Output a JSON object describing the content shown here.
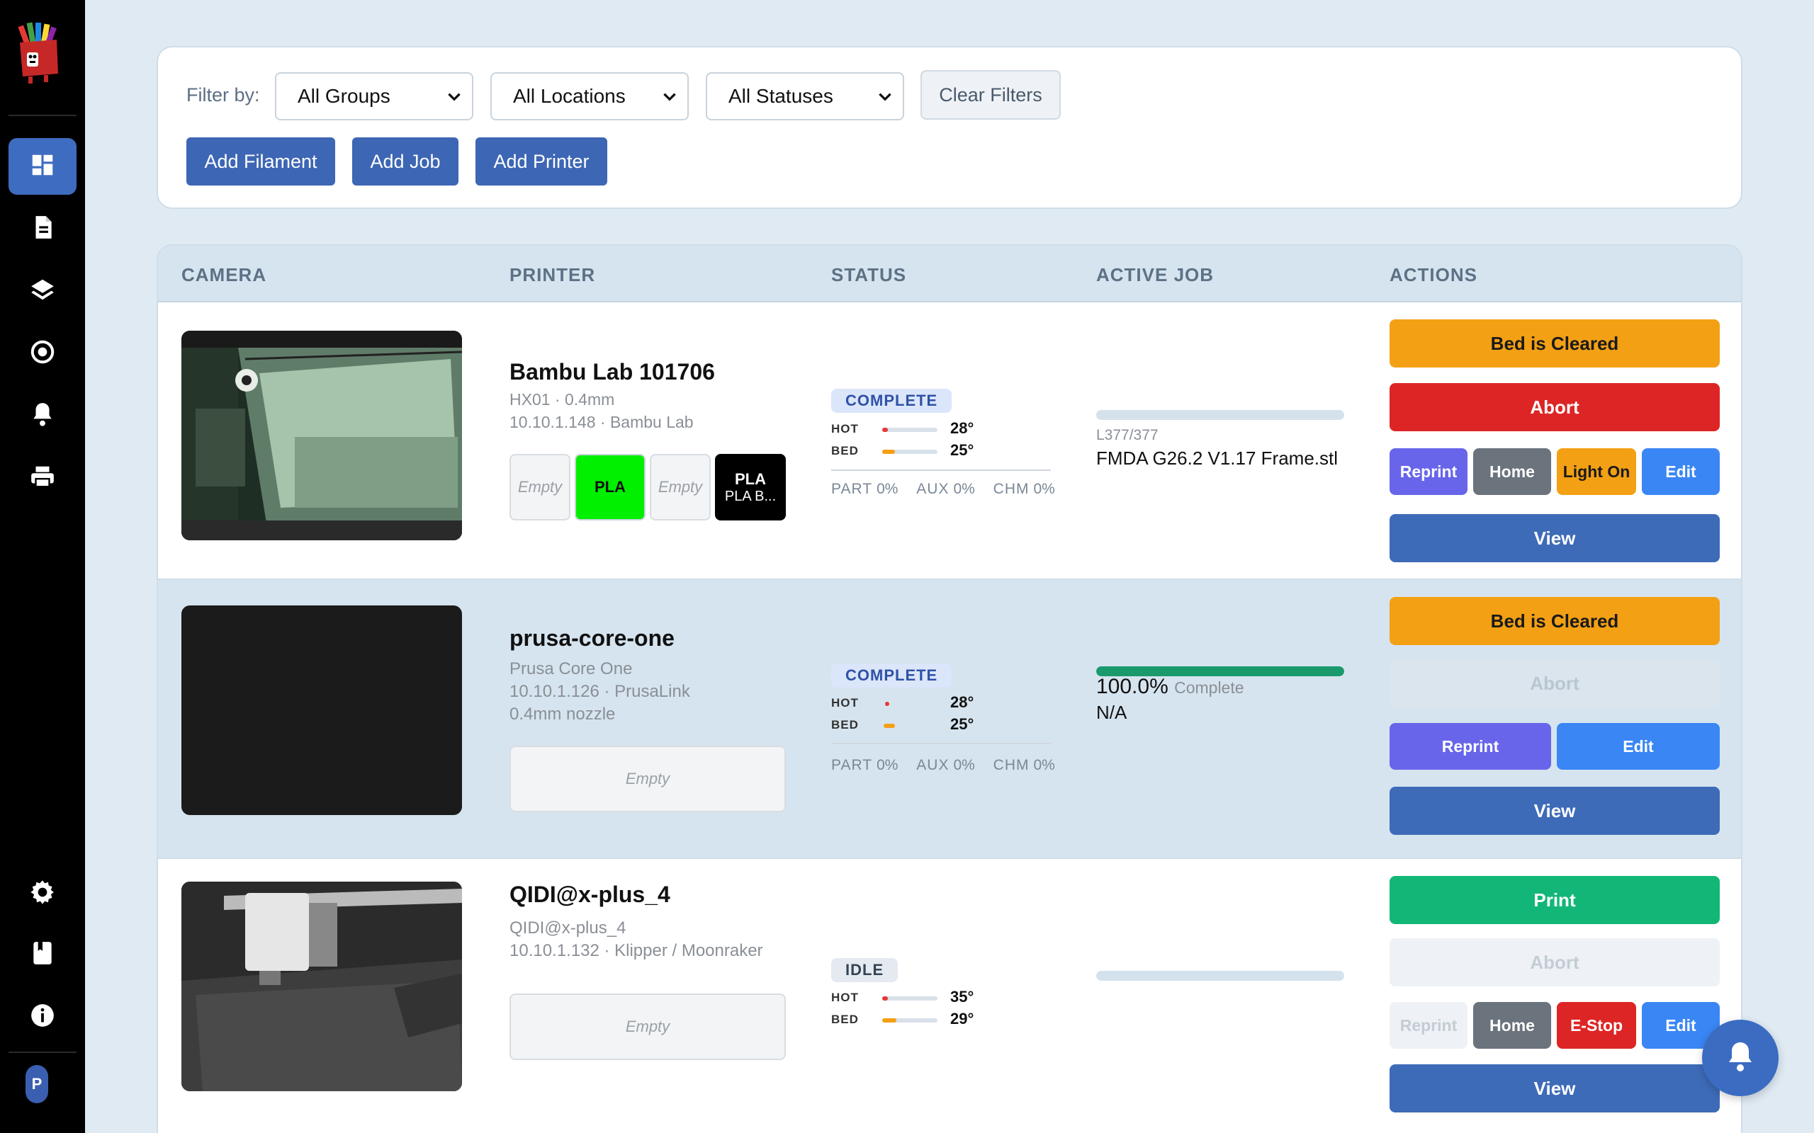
{
  "app": {
    "avatar_letter": "P"
  },
  "sidebar": {
    "items": [
      {
        "icon": "dashboard-icon"
      },
      {
        "icon": "document-icon"
      },
      {
        "icon": "layers-icon"
      },
      {
        "icon": "target-icon"
      },
      {
        "icon": "bell-icon"
      },
      {
        "icon": "printer-icon"
      },
      {
        "icon": "gear-icon"
      },
      {
        "icon": "book-icon"
      },
      {
        "icon": "info-icon"
      }
    ]
  },
  "filters": {
    "label": "Filter by:",
    "groups": "All Groups",
    "locations": "All Locations",
    "statuses": "All Statuses",
    "clear": "Clear Filters",
    "add_filament": "Add Filament",
    "add_job": "Add Job",
    "add_printer": "Add Printer"
  },
  "table": {
    "headers": {
      "camera": "CAMERA",
      "printer": "PRINTER",
      "status": "STATUS",
      "active_job": "ACTIVE JOB",
      "actions": "ACTIONS"
    },
    "rows": [
      {
        "name": "Bambu Lab 101706",
        "model": "HX01 · 0.4mm",
        "address": "10.10.1.148 · Bambu Lab",
        "slots": [
          {
            "label": "Empty"
          },
          {
            "label": "PLA"
          },
          {
            "label": "Empty"
          },
          {
            "label": "PLA",
            "sub": "PLA B..."
          }
        ],
        "status": "COMPLETE",
        "hot_label": "HOT",
        "hot": "28°",
        "bed_label": "BED",
        "bed": "25°",
        "fans": {
          "part_label": "PART",
          "part": "0%",
          "aux_label": "AUX",
          "aux": "0%",
          "chm_label": "CHM",
          "chm": "0%"
        },
        "job_layer": "L377/377",
        "job_file": "FMDA G26.2 V1.17 Frame.stl",
        "actions": {
          "bed_cleared": "Bed is Cleared",
          "abort": "Abort",
          "reprint": "Reprint",
          "home": "Home",
          "light": "Light On",
          "edit": "Edit",
          "view": "View"
        }
      },
      {
        "name": "prusa-core-one",
        "model": "Prusa Core One",
        "address": "10.10.1.126 · PrusaLink",
        "nozzle": "0.4mm nozzle",
        "slots": [
          {
            "label": "Empty"
          }
        ],
        "status": "COMPLETE",
        "hot_label": "HOT",
        "hot": "28°",
        "bed_label": "BED",
        "bed": "25°",
        "fans": {
          "part_label": "PART",
          "part": "0%",
          "aux_label": "AUX",
          "aux": "0%",
          "chm_label": "CHM",
          "chm": "0%"
        },
        "progress": 1.0,
        "job_pct": "100.0%",
        "job_pct_label": "Complete",
        "job_file": "N/A",
        "actions": {
          "bed_cleared": "Bed is Cleared",
          "abort": "Abort",
          "reprint": "Reprint",
          "edit": "Edit",
          "view": "View"
        }
      },
      {
        "name": "QIDI@x-plus_4",
        "model": "QIDI@x-plus_4",
        "address": "10.10.1.132 · Klipper / Moonraker",
        "slots": [
          {
            "label": "Empty"
          }
        ],
        "status": "IDLE",
        "hot_label": "HOT",
        "hot": "35°",
        "bed_label": "BED",
        "bed": "29°",
        "progress": 0,
        "actions": {
          "print": "Print",
          "abort": "Abort",
          "reprint": "Reprint",
          "home": "Home",
          "estop": "E-Stop",
          "edit": "Edit",
          "view": "View"
        }
      }
    ]
  },
  "colors": {
    "sidebar_bg": "#000000",
    "accent": "#3e6bb8",
    "bed_cleared": "#f4a014",
    "abort": "#dd2525",
    "reprint": "#6865ea",
    "home": "#6b737d",
    "edit": "#3a86f5",
    "print": "#12b777",
    "progress": "#1a9a6c"
  }
}
